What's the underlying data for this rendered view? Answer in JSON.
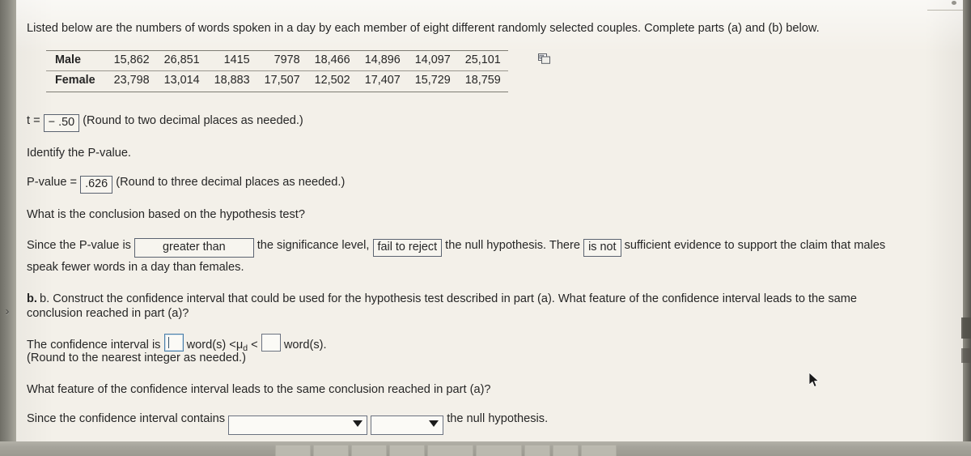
{
  "problem": {
    "intro": "Listed below are the numbers of words spoken in a day by each member of eight different randomly selected couples. Complete parts (a) and (b) below.",
    "table": {
      "rows": [
        {
          "label": "Male",
          "values": [
            "15,862",
            "26,851",
            "1415",
            "7978",
            "18,466",
            "14,896",
            "14,097",
            "25,101"
          ]
        },
        {
          "label": "Female",
          "values": [
            "23,798",
            "13,014",
            "18,883",
            "17,507",
            "12,502",
            "17,407",
            "15,729",
            "18,759"
          ]
        }
      ]
    },
    "copy_icon": "copy-to-clipboard-icon"
  },
  "part_a": {
    "t_label": "t =",
    "t_value": "− .50",
    "t_hint": "(Round to two decimal places as needed.)",
    "identify_pvalue": "Identify the P-value.",
    "pvalue_label": "P-value =",
    "pvalue_value": ".626",
    "pvalue_hint": "(Round to three decimal places as needed.)",
    "conclusion_question": "What is the conclusion based on the hypothesis test?",
    "since_prefix": "Since the P-value is",
    "comparison_value": "greater than",
    "sig_level_text": "the significance level,",
    "decision_value": "fail to reject",
    "null_hyp_text": "the null hypothesis. There",
    "evidence_value": "is not",
    "evidence_tail": "sufficient evidence to support the claim that males",
    "conclusion_line2": "speak fewer words in a day than females."
  },
  "part_b": {
    "prompt_line1": "b. Construct the confidence interval that could be used for the hypothesis test described in part (a). What feature of the confidence interval leads to the same",
    "prompt_line2": "conclusion reached in part (a)?",
    "ci_prefix": "The confidence interval is",
    "ci_lower_value": "",
    "ci_mid_left": "word(s) <",
    "ci_symbol": "μ",
    "ci_symbol_sub": "d",
    "ci_mid_right": "<",
    "ci_upper_value": "",
    "ci_suffix": "word(s).",
    "ci_hint": "(Round to the nearest integer as needed.)",
    "feature_question": "What feature of the confidence interval leads to the same conclusion reached in part (a)?",
    "contains_prefix": "Since the confidence interval contains",
    "dropdown1_value": "",
    "dropdown2_value": "",
    "contains_suffix": "the null hypothesis."
  },
  "chrome": {
    "left_chevron": "›",
    "taskbar_buttons": [
      "",
      "",
      "",
      "",
      "",
      "",
      "",
      "",
      ""
    ],
    "cursor": "arrow-cursor"
  },
  "colors": {
    "page_background": "#f3f0e9",
    "text": "#262626",
    "box_border": "#5b6370",
    "focused_border": "#4a7ea8",
    "desktop": "#9a988e",
    "taskbar": "#a5a39a"
  }
}
